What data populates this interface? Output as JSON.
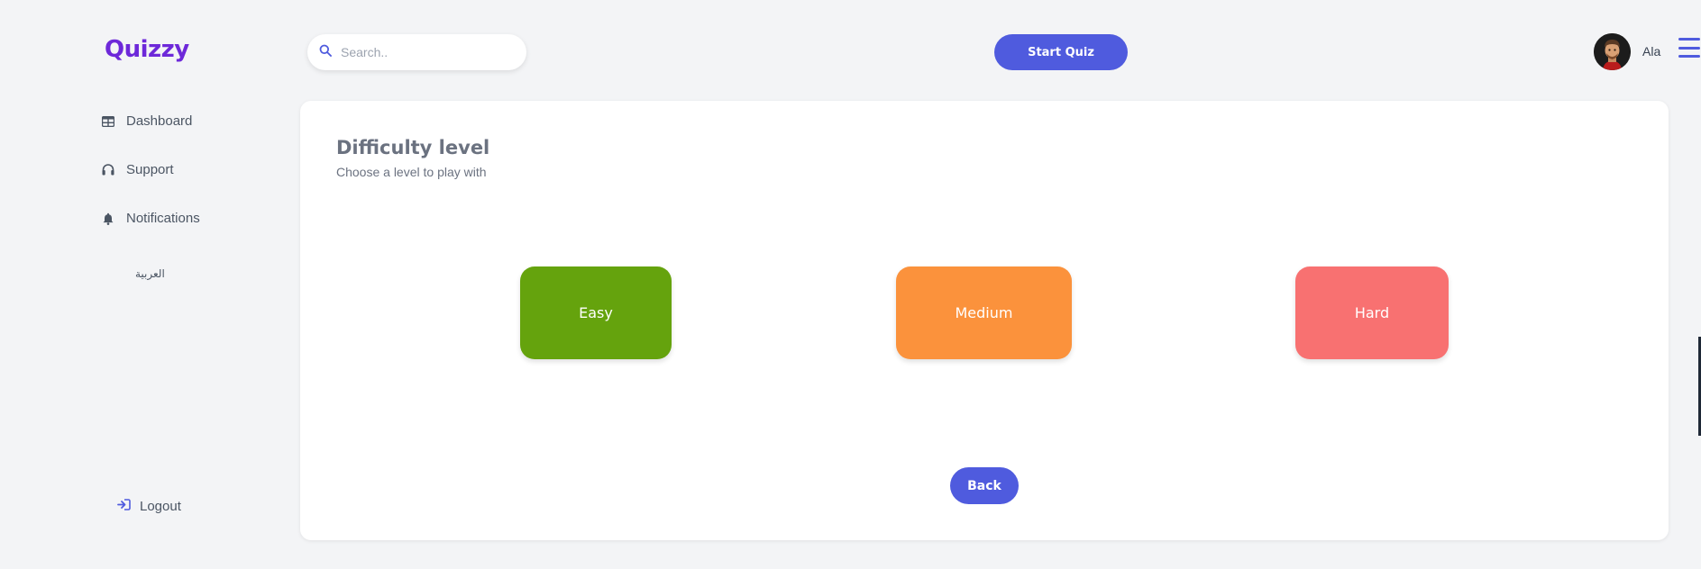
{
  "app": {
    "logo": "Quizzy"
  },
  "sidebar": {
    "items": [
      {
        "label": "Dashboard",
        "icon": "table-icon"
      },
      {
        "label": "Support",
        "icon": "headphones-icon"
      },
      {
        "label": "Notifications",
        "icon": "bell-icon"
      }
    ],
    "language_link": "العربية",
    "logout_label": "Logout"
  },
  "topbar": {
    "search": {
      "placeholder": "Search..",
      "value": ""
    },
    "start_quiz_label": "Start Quiz",
    "user_name": "Ala"
  },
  "main": {
    "title": "Difficulty level",
    "subtitle": "Choose a level to play with",
    "levels": [
      {
        "label": "Easy",
        "color": "#65a30d"
      },
      {
        "label": "Medium",
        "color": "#fb923c"
      },
      {
        "label": "Hard",
        "color": "#f87171"
      }
    ],
    "back_label": "Back"
  },
  "colors": {
    "accent": "#4f5bde",
    "logo": "#6d28d9",
    "background": "#f3f4f6"
  }
}
